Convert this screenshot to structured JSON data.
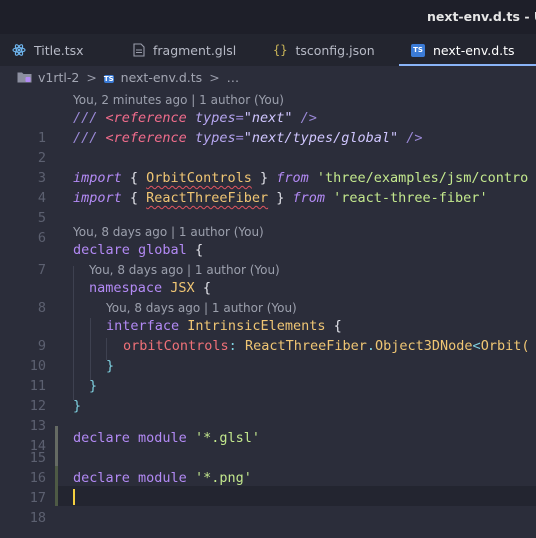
{
  "window": {
    "title": "next-env.d.ts - Unt"
  },
  "tabs": [
    {
      "label": "Title.tsx",
      "icon": "react-icon",
      "active": false
    },
    {
      "label": "fragment.glsl",
      "icon": "file-icon",
      "active": false
    },
    {
      "label": "tsconfig.json",
      "icon": "json-braces-icon",
      "active": false
    },
    {
      "label": "next-env.d.ts",
      "icon": "ts-icon",
      "active": true
    }
  ],
  "ts_badge": "TS",
  "breadcrumb": {
    "folder": "v1rtl-2",
    "separator": ">",
    "file": "next-env.d.ts",
    "trailing": "…"
  },
  "blame": {
    "b1": "You, 2 minutes ago | 1 author (You)",
    "b7": "You, 8 days ago | 1 author (You)",
    "b8": "You, 8 days ago | 1 author (You)",
    "b9": "You, 8 days ago | 1 author (You)"
  },
  "lines": {
    "l1": {
      "num": "1",
      "t1": "/// ",
      "t2": "<",
      "t3": "reference",
      "t4": " ",
      "t5": "types",
      "t6": "=",
      "t7": "\"next\"",
      "t8": " />"
    },
    "l2": {
      "num": "2",
      "t1": "/// ",
      "t2": "<",
      "t3": "reference",
      "t4": " ",
      "t5": "types",
      "t6": "=",
      "t7": "\"next/types/global\"",
      "t8": " />"
    },
    "l3": {
      "num": "3"
    },
    "l4": {
      "num": "4",
      "t1": "import",
      "t2": " { ",
      "t3": "OrbitControls",
      "t4": " } ",
      "t5": "from",
      "t6": " ",
      "t7": "'three/examples/jsm/contro"
    },
    "l5": {
      "num": "5",
      "t1": "import",
      "t2": " { ",
      "t3": "ReactThreeFiber",
      "t4": " } ",
      "t5": "from",
      "t6": " ",
      "t7": "'react-three-fiber'"
    },
    "l6": {
      "num": "6"
    },
    "l7": {
      "num": "7",
      "t1": "declare",
      "t2": " ",
      "t3": "global",
      "t4": " {"
    },
    "l8": {
      "num": "8",
      "t1": "namespace",
      "t2": " ",
      "t3": "JSX",
      "t4": " {"
    },
    "l9": {
      "num": "9",
      "t1": "interface",
      "t2": " ",
      "t3": "IntrinsicElements",
      "t4": " {"
    },
    "l10": {
      "num": "10",
      "t1": "orbitControls",
      "t2": ": ",
      "t3": "ReactThreeFiber",
      "t4": ".",
      "t5": "Object3DNode",
      "t6": "<",
      "t7": "Orbit("
    },
    "l11": {
      "num": "11",
      "t1": "}"
    },
    "l12": {
      "num": "12",
      "t1": "}"
    },
    "l13": {
      "num": "13",
      "t1": "}"
    },
    "l14": {
      "num": "14"
    },
    "l15": {
      "num": "15",
      "t1": "declare",
      "t2": " ",
      "t3": "module",
      "t4": " ",
      "t5": "'*.glsl'"
    },
    "l16": {
      "num": "16"
    },
    "l17": {
      "num": "17",
      "t1": "declare",
      "t2": " ",
      "t3": "module",
      "t4": " ",
      "t5": "'*.png'"
    },
    "l18": {
      "num": "18"
    }
  },
  "colors": {
    "editor_bg": "#2b2d3a",
    "titlebar_bg": "#1e1f29",
    "tabbar_bg": "#23252f",
    "active_tab_underline": "#8ab4f8",
    "cursor": "#f4d03f",
    "keyword": "#b38af5",
    "string": "#c3e88d",
    "class": "#f0c674",
    "type": "#7fd1e0",
    "property": "#f07178",
    "error_squiggle": "#e05561"
  }
}
